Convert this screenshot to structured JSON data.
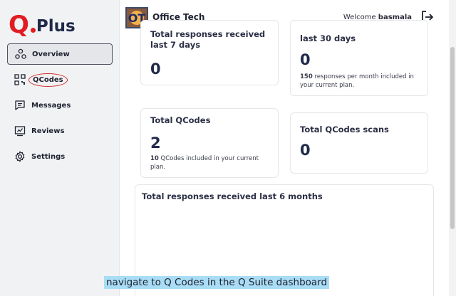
{
  "brand": {
    "logo_q": "Q",
    "logo_plus": "Plus",
    "accent": "#e21c23"
  },
  "sidebar": {
    "items": [
      {
        "label": "Overview",
        "icon": "nodes-icon",
        "active": true
      },
      {
        "label": "QCodes",
        "icon": "qr-code-icon",
        "active": false
      },
      {
        "label": "Messages",
        "icon": "message-icon",
        "active": false
      },
      {
        "label": "Reviews",
        "icon": "review-icon",
        "active": false
      },
      {
        "label": "Settings",
        "icon": "gear-icon",
        "active": false
      }
    ]
  },
  "header": {
    "company_logo_text": "OT",
    "company_name": "Office Tech",
    "welcome_prefix": "Welcome",
    "username": "basmala",
    "logout_icon": "logout-icon"
  },
  "cards": {
    "responses_7d": {
      "title": "Total responses received last 7 days",
      "value": "0"
    },
    "responses_30d": {
      "title": "last 30 days",
      "value": "0",
      "note_bold": "150",
      "note": " responses per month included in your current plan."
    },
    "total_qcodes": {
      "title": "Total QCodes",
      "value": "2",
      "note_bold": "10",
      "note": " QCodes included in your current plan."
    },
    "qcode_scans": {
      "title": "Total QCodes scans",
      "value": "0"
    },
    "responses_6m": {
      "title": "Total responses received last 6 months"
    }
  },
  "caption": "navigate to Q Codes in the Q Suite dashboard"
}
